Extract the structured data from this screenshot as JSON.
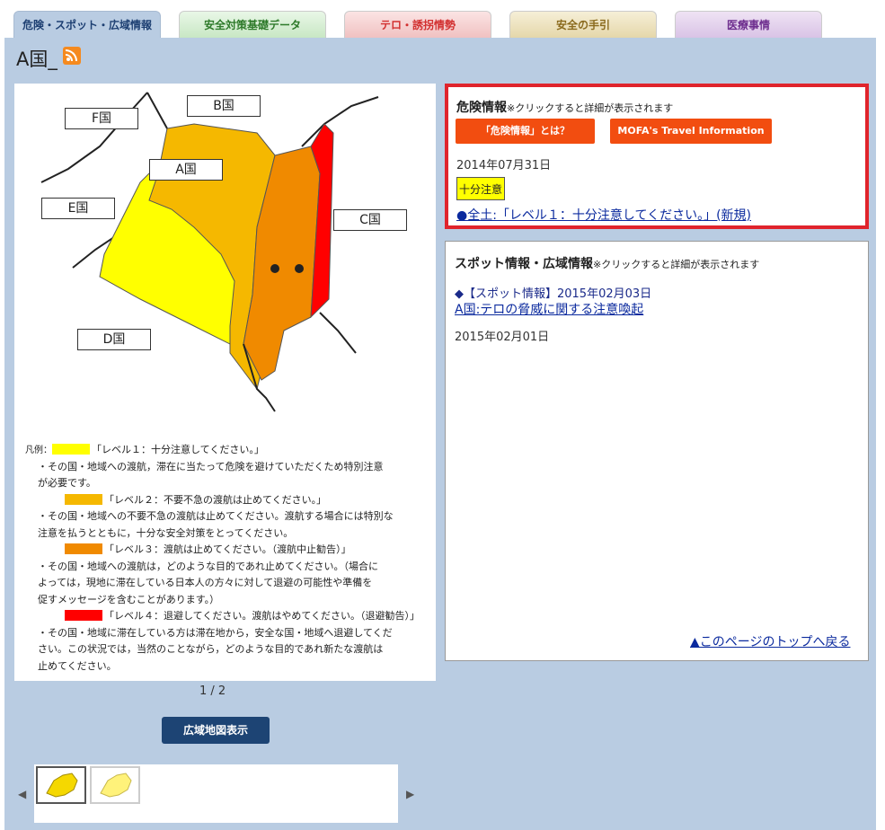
{
  "tabs": [
    {
      "label": "危険・スポット・広域情報"
    },
    {
      "label": "安全対策基礎データ"
    },
    {
      "label": "テロ・誘拐情勢"
    },
    {
      "label": "安全の手引"
    },
    {
      "label": "医療事情"
    }
  ],
  "country_title": "A国_",
  "map": {
    "labels": [
      "B国",
      "F国",
      "A国",
      "E国",
      "C国",
      "D国"
    ],
    "legend_title": "凡例：",
    "legend_rows": [
      "「レベル１：十分注意してください。」",
      "・その国・地域への渡航，滞在に当たって危険を避けていただくため特別注意",
      "が必要です。",
      "「レベル２：不要不急の渡航は止めてください。」",
      "・その国・地域への不要不急の渡航は止めてください。渡航する場合には特別な",
      "注意を払うとともに，十分な安全対策をとってください。",
      "「レベル３：渡航は止めてください。（渡航中止勧告）」",
      "・その国・地域への渡航は，どのような目的であれ止めてください。（場合に",
      "よっては，現地に滞在している日本人の方々に対して退避の可能性や準備を",
      "促すメッセージを含むことがあります。）",
      "「レベル４：退避してください。渡航はやめてください。（退避勧告）」",
      "・その国・地域に滞在している方は滞在地から，安全な国・地域へ退避してくだ",
      "さい。この状況では，当然のことながら，どのような目的であれ新たな渡航は",
      "止めてください。"
    ],
    "level_colors": [
      "#ffff00",
      "#f5b800",
      "#f08a00",
      "#ff0000"
    ]
  },
  "pager": "1 / 2",
  "wide_map_button": "広域地図表示",
  "danger_box": {
    "title": "危険情報",
    "note": "※クリックすると詳細が表示されます",
    "btn_about": "「危険情報」とは？",
    "btn_mofa": "MOFA's Travel Information",
    "date": "2014年07月31日",
    "badge": "十分注意",
    "link": "●全土:「レベル１：十分注意してください。」(新規)"
  },
  "spot_box": {
    "title": "スポット情報・広域情報",
    "note": "※クリックすると詳細が表示されます",
    "item_prefix": "◆【スポット情報】2015年02月03日",
    "item_link": "A国:テロの脅威に関する注意喚起",
    "date2": "2015年02月01日",
    "back_to_top": "▲このページのトップへ戻る"
  }
}
